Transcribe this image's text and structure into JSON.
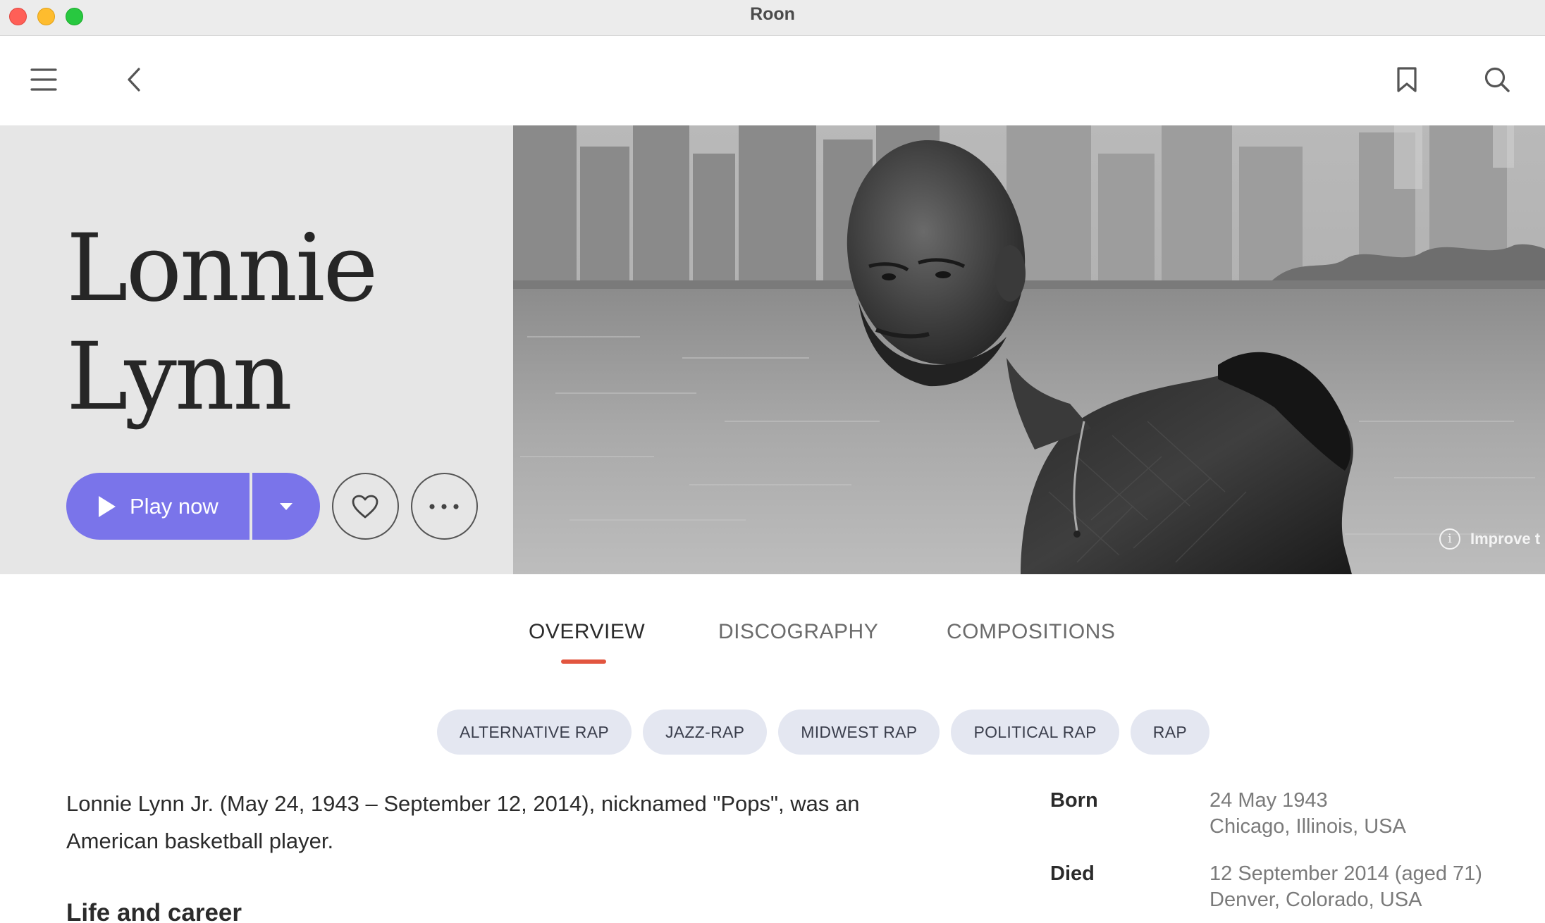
{
  "window": {
    "title": "Roon"
  },
  "toolbar": {
    "menu_icon": "hamburger-menu-icon",
    "back_icon": "chevron-left-icon",
    "bookmark_icon": "bookmark-icon",
    "search_icon": "search-icon"
  },
  "artist": {
    "name_line1": "Lonnie",
    "name_line2": "Lynn",
    "photo_caption": "Improve t"
  },
  "actions": {
    "play_label": "Play now",
    "accent_color": "#7a74ea"
  },
  "tabs": [
    {
      "label": "OVERVIEW",
      "active": true
    },
    {
      "label": "DISCOGRAPHY",
      "active": false
    },
    {
      "label": "COMPOSITIONS",
      "active": false
    }
  ],
  "genres": [
    "ALTERNATIVE RAP",
    "JAZZ-RAP",
    "MIDWEST RAP",
    "POLITICAL RAP",
    "RAP"
  ],
  "bio": {
    "intro": "Lonnie Lynn Jr. (May 24, 1943 – September 12, 2014), nicknamed \"Pops\", was an American basketball player.",
    "section_heading": "Life and career"
  },
  "facts": {
    "born_label": "Born",
    "born_date": "24 May 1943",
    "born_place": "Chicago, Illinois, USA",
    "died_label": "Died",
    "died_date": "12 September 2014 (aged 71)",
    "died_place": "Denver, Colorado, USA"
  }
}
